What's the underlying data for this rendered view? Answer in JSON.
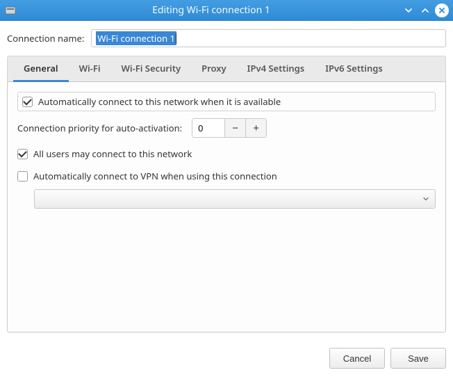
{
  "window": {
    "title": "Editing Wi-Fi connection 1"
  },
  "connection_name": {
    "label": "Connection name:",
    "value": "Wi-Fi connection 1"
  },
  "tabs": [
    {
      "label": "General",
      "active": true
    },
    {
      "label": "Wi-Fi",
      "active": false
    },
    {
      "label": "Wi-Fi Security",
      "active": false
    },
    {
      "label": "Proxy",
      "active": false
    },
    {
      "label": "IPv4 Settings",
      "active": false
    },
    {
      "label": "IPv6 Settings",
      "active": false
    }
  ],
  "general": {
    "auto_connect": {
      "label": "Automatically connect to this network when it is available",
      "checked": true
    },
    "priority": {
      "label": "Connection priority for auto-activation:",
      "value": "0"
    },
    "all_users": {
      "label": "All users may connect to this network",
      "checked": true
    },
    "auto_vpn": {
      "label": "Automatically connect to VPN when using this connection",
      "checked": false
    },
    "vpn_select": {
      "value": ""
    }
  },
  "buttons": {
    "cancel": "Cancel",
    "save": "Save"
  }
}
